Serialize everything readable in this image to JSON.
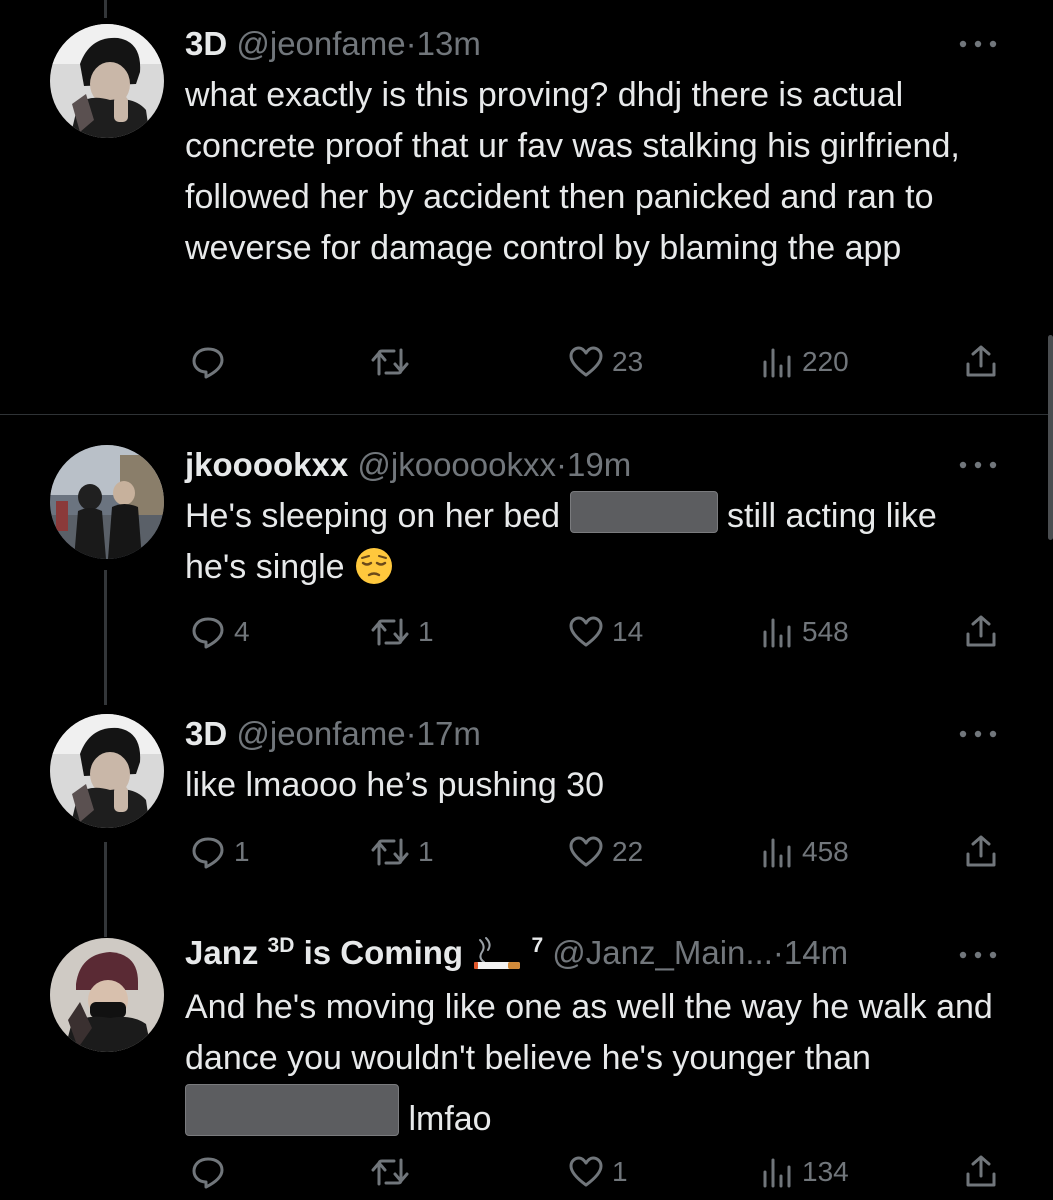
{
  "tweets": [
    {
      "name": "3D",
      "handle": "@jeonfame",
      "dot": "·",
      "time": "13m",
      "text": "what exactly is this proving? dhdj there is actual concrete proof that ur fav was stalking his girlfriend, followed her by accident then panicked and ran to weverse for damage control by blaming the app",
      "replies": "",
      "retweets": "",
      "likes": "23",
      "views": "220"
    },
    {
      "name": "jkooookxx",
      "handle": "@jkoooookxx",
      "dot": "·",
      "time": "19m",
      "text_before": "He's sleeping on her bed",
      "text_after": "still acting like he's single",
      "emoji": "pensive-face",
      "replies": "4",
      "retweets": "1",
      "likes": "14",
      "views": "548"
    },
    {
      "name": "3D",
      "handle": "@jeonfame",
      "dot": "·",
      "time": "17m",
      "text": "like lmaooo he’s pushing 30",
      "replies": "1",
      "retweets": "1",
      "likes": "22",
      "views": "458"
    },
    {
      "name_part1": "Janz",
      "name_sup": "3D",
      "name_part2": "is Coming",
      "name_badge_emoji": "cigarette",
      "name_sup2": "7",
      "handle": "@Janz_Main...",
      "dot": "·",
      "time": "14m",
      "text_before": "And he's moving like one as well the way he walk and dance you wouldn't believe he's younger than",
      "text_after": "lmfao",
      "replies": "",
      "retweets": "",
      "likes": "1",
      "views": "134"
    }
  ],
  "icons": {
    "reply": "reply-icon",
    "retweet": "retweet-icon",
    "like": "heart-icon",
    "views": "views-icon",
    "share": "share-icon",
    "more": "more-icon"
  },
  "colors": {
    "background": "#000000",
    "text": "#e7e9ea",
    "muted": "#71767b",
    "divider": "#2f3336"
  }
}
